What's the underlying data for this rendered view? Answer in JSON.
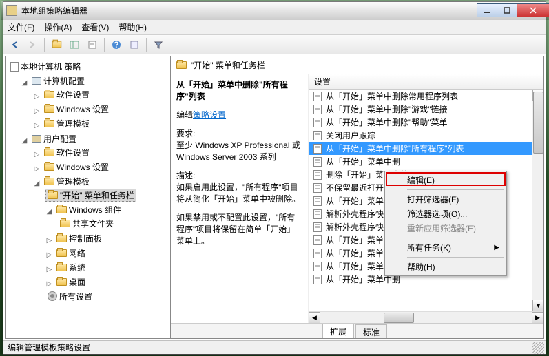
{
  "title": "本地组策略编辑器",
  "menus": {
    "file": "文件(F)",
    "action": "操作(A)",
    "view": "查看(V)",
    "help": "帮助(H)"
  },
  "tree": {
    "root": "本地计算机 策略",
    "n1": "计算机配置",
    "n11": "软件设置",
    "n12": "Windows 设置",
    "n13": "管理模板",
    "n2": "用户配置",
    "n21": "软件设置",
    "n22": "Windows 设置",
    "n23": "管理模板",
    "n231": "\"开始\" 菜单和任务栏",
    "n232": "Windows 组件",
    "n2321": "共享文件夹",
    "n233": "控制面板",
    "n234": "网络",
    "n235": "系统",
    "n236": "桌面",
    "n237": "所有设置"
  },
  "header": {
    "title": "\"开始\" 菜单和任务栏"
  },
  "desc": {
    "title": "从「开始」菜单中删除\"所有程序\"列表",
    "edit_prefix": "编辑",
    "edit_link": "策略设置",
    "req_label": "要求:",
    "req_text": "至少 Windows XP Professional 或 Windows Server 2003 系列",
    "d_label": "描述:",
    "d1": "如果启用此设置，\"所有程序\"项目将从简化「开始」菜单中被删除。",
    "d2": "如果禁用或不配置此设置，\"所有程序\"项目将保留在简单「开始」菜单上。"
  },
  "list": {
    "column": "设置",
    "items": [
      "从「开始」菜单中删除常用程序列表",
      "从「开始」菜单中删除\"游戏\"链接",
      "从「开始」菜单中删除\"帮助\"菜单",
      "关闭用户跟踪",
      "从「开始」菜单中删除\"所有程序\"列表",
      "从「开始」菜单中删",
      "删除「开始」菜单中的",
      "不保留最近打开文档",
      "从「开始」菜单中删",
      "解析外壳程序快捷",
      "解析外壳程序快捷",
      "从「开始」菜单中删",
      "从「开始」菜单中删除\"默认程序\"链接。",
      "从「开始」菜单中删除\"文档\"图标",
      "从「开始」菜单中删"
    ],
    "selected": 4
  },
  "ctx": {
    "edit": "编辑(E)",
    "openfilter": "打开筛选器(F)",
    "filteropts": "筛选器选项(O)...",
    "reapply": "重新应用筛选器(E)",
    "alltasks": "所有任务(K)",
    "help": "帮助(H)"
  },
  "tabs": {
    "ext": "扩展",
    "std": "标准"
  },
  "status": "编辑管理模板策略设置"
}
